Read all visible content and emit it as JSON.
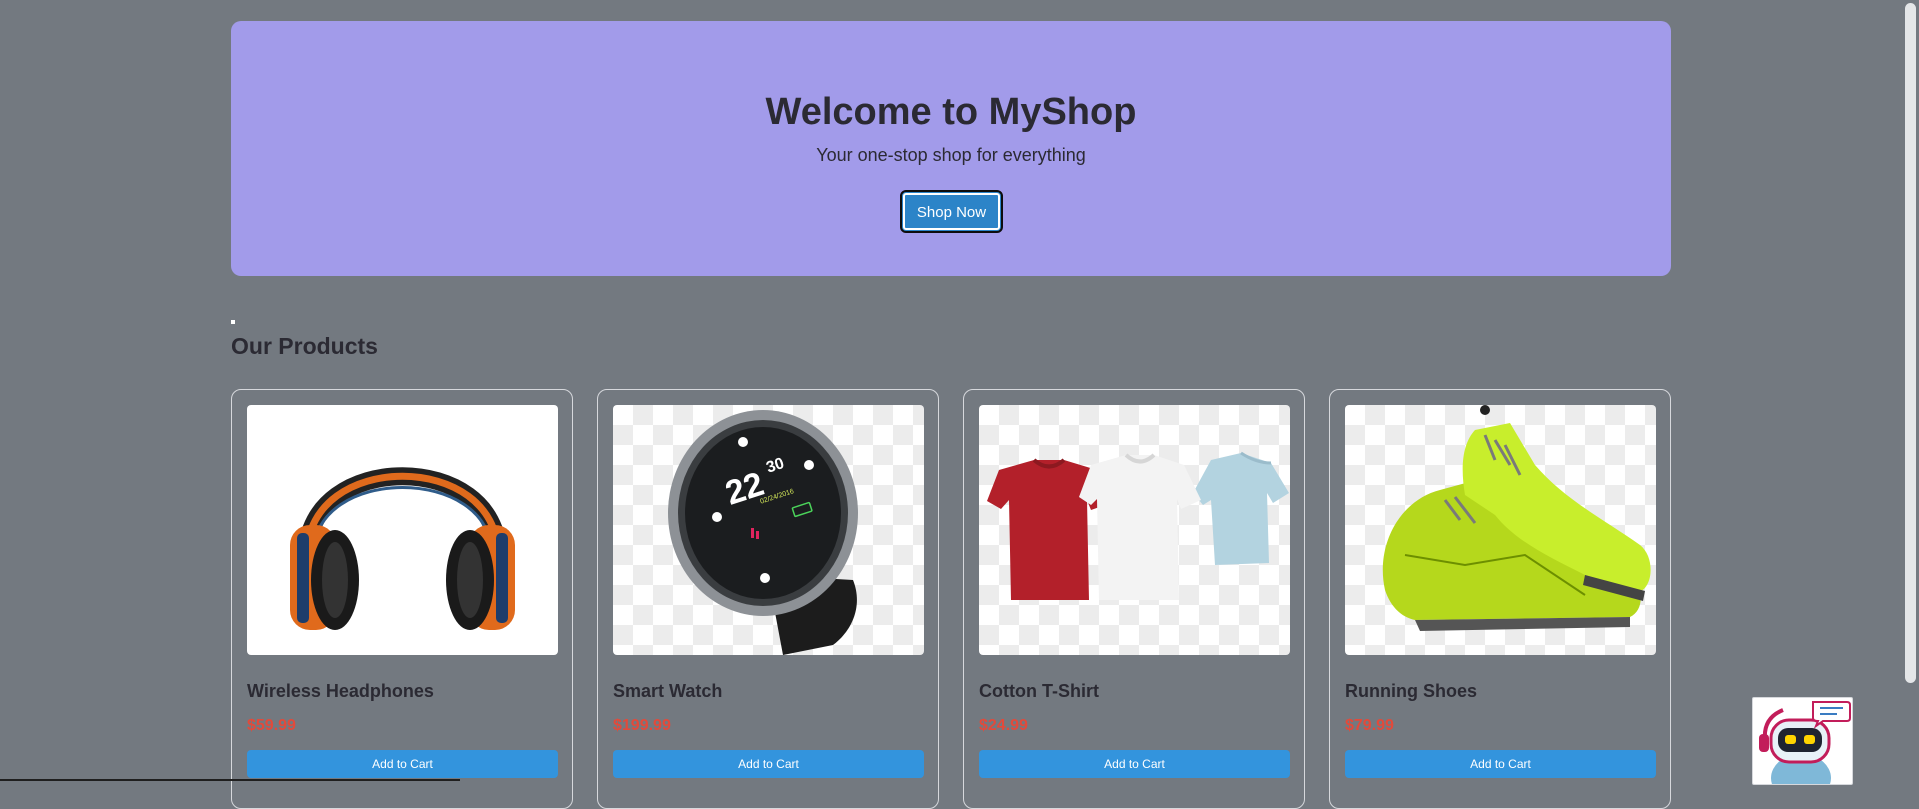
{
  "hero": {
    "title": "Welcome to MyShop",
    "subtitle": "Your one-stop shop for everything",
    "button_label": "Shop Now"
  },
  "section_title": "Our Products",
  "products": [
    {
      "name": "Wireless Headphones",
      "price": "$59.99",
      "button": "Add to Cart",
      "icon": "headphones-image"
    },
    {
      "name": "Smart Watch",
      "price": "$199.99",
      "button": "Add to Cart",
      "icon": "smartwatch-image"
    },
    {
      "name": "Cotton T-Shirt",
      "price": "$24.99",
      "button": "Add to Cart",
      "icon": "tshirts-image"
    },
    {
      "name": "Running Shoes",
      "price": "$79.99",
      "button": "Add to Cart",
      "icon": "running-shoes-image"
    }
  ],
  "watch_face": {
    "time_hours": "22",
    "time_minutes": "30",
    "date": "02/24/2016"
  },
  "chatbot": {
    "icon": "chatbot-robot-icon"
  },
  "colors": {
    "background": "#737980",
    "hero_background": "#a29bea",
    "primary_button": "#2c84c8",
    "cart_button": "#3394dd",
    "price": "#e24a3b"
  }
}
